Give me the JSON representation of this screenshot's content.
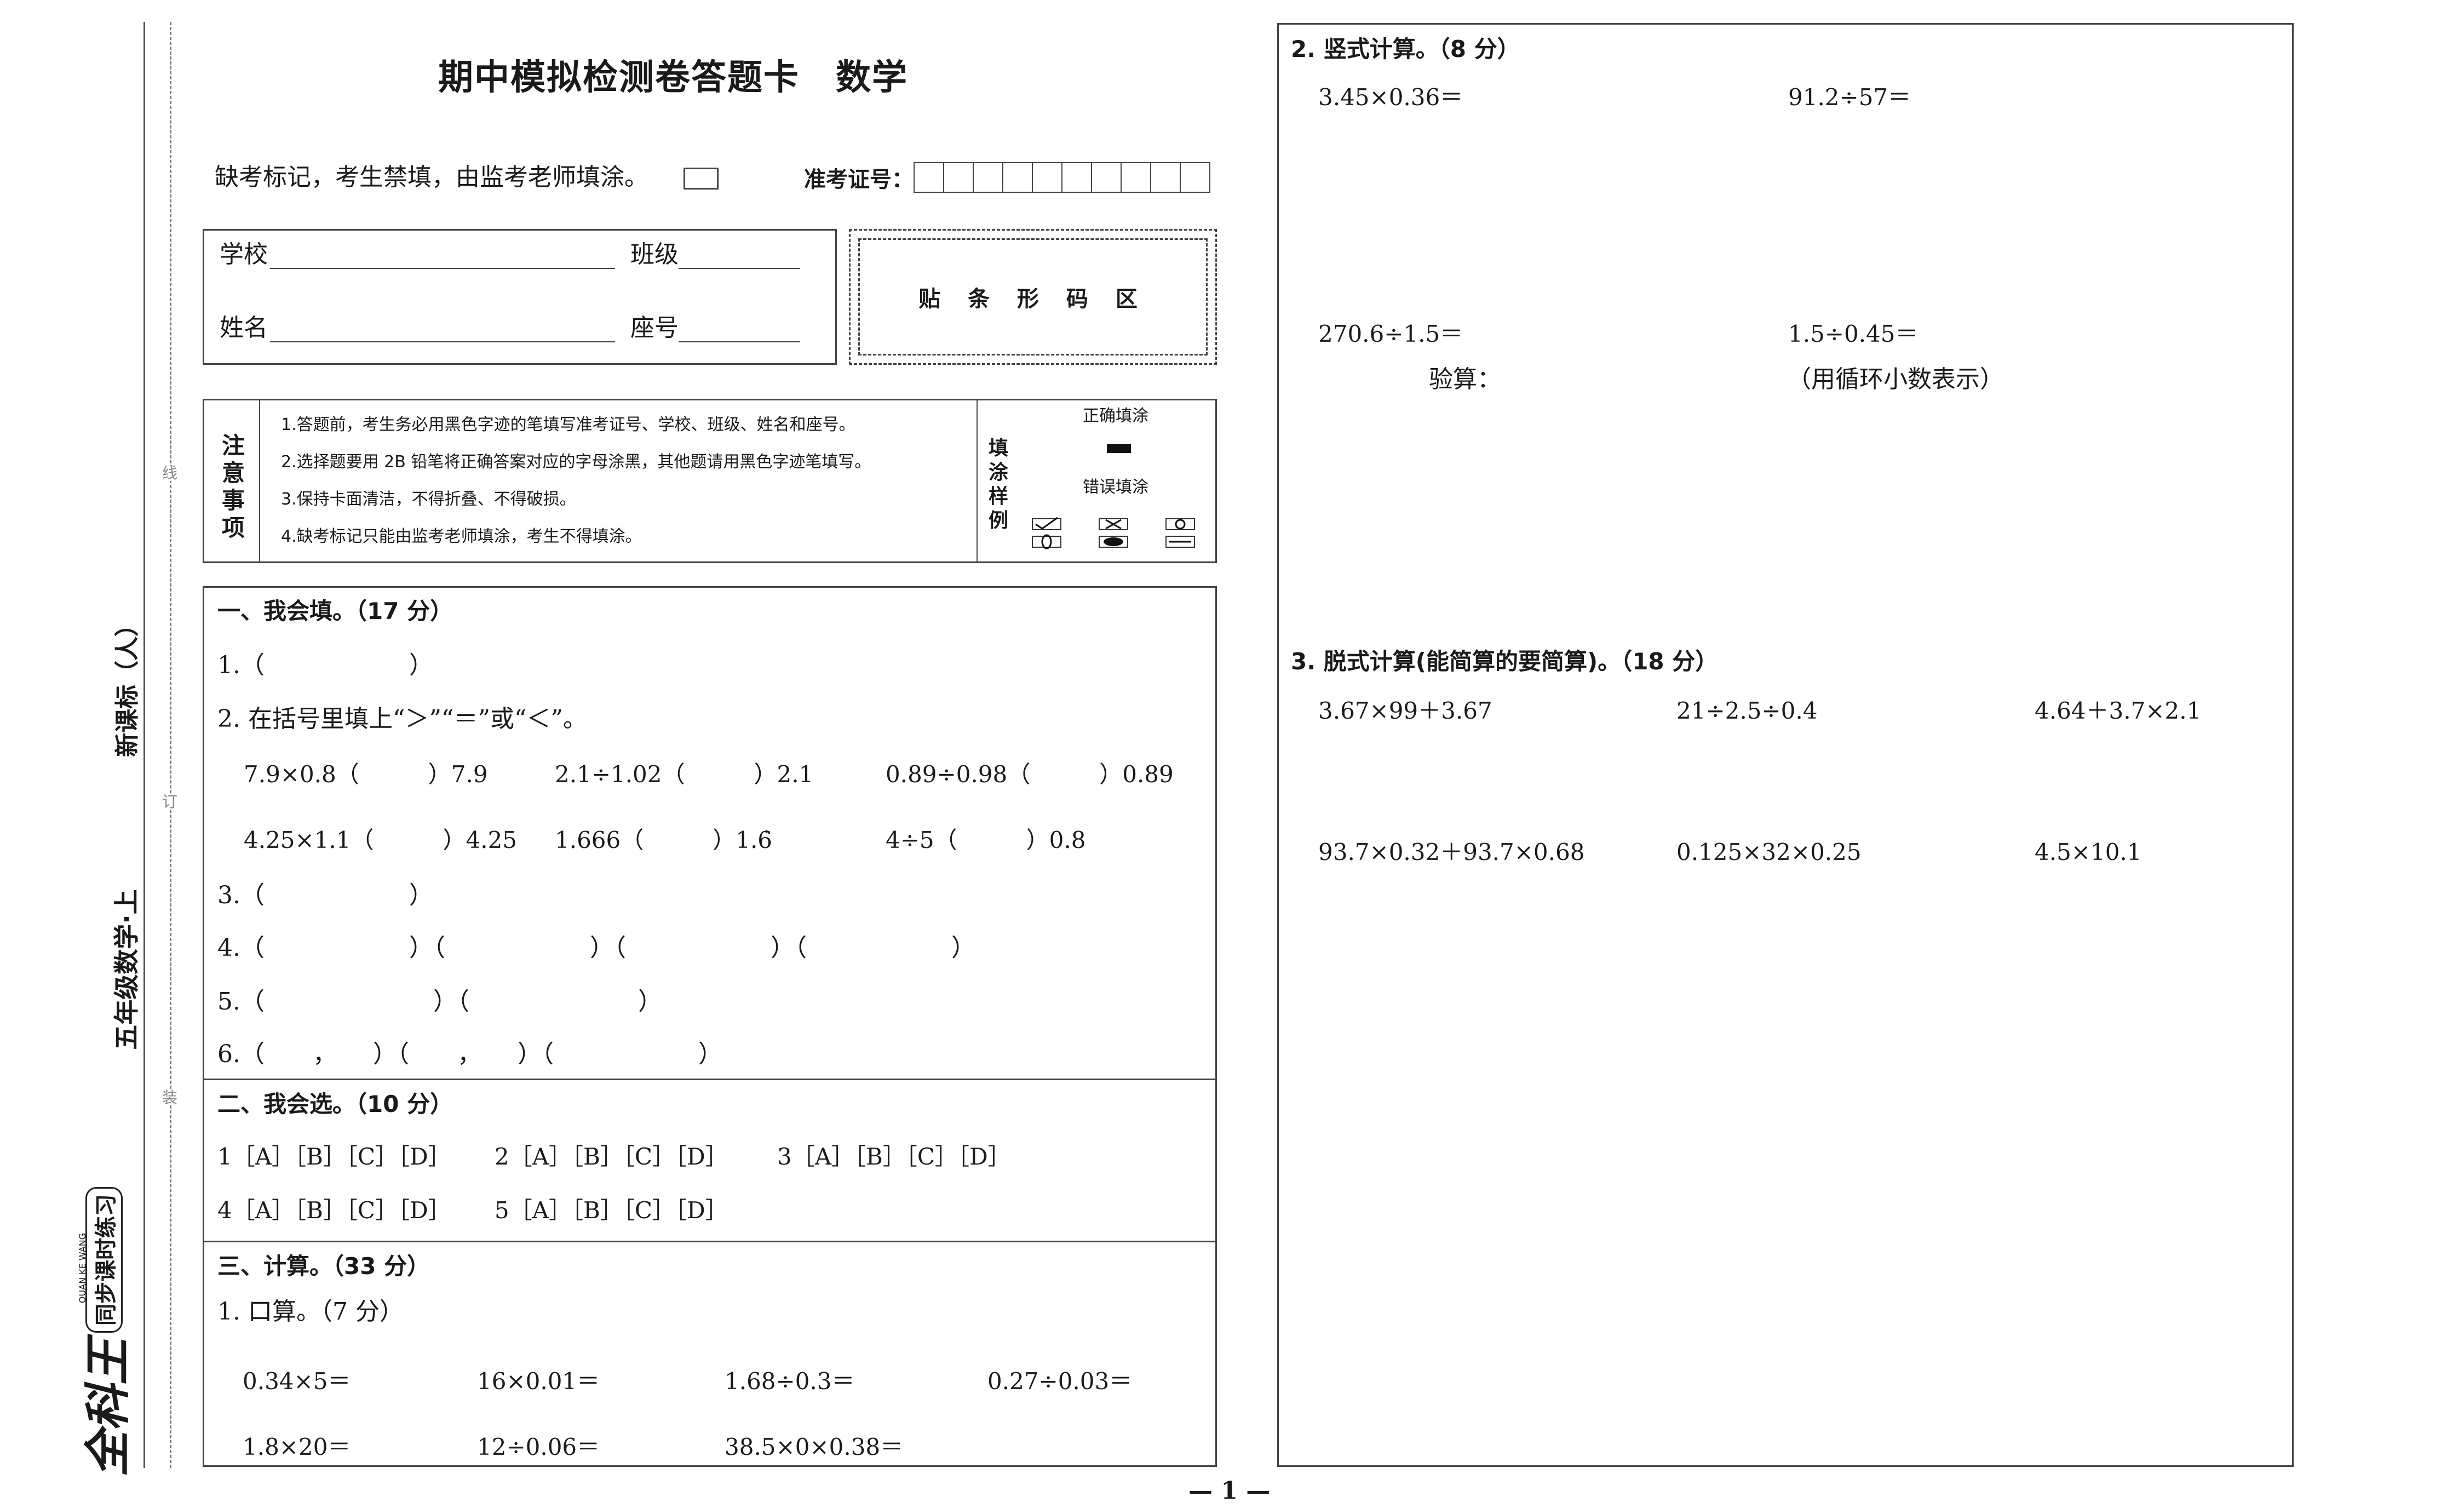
{
  "spine": {
    "edition": "新课标（人）",
    "grade_book": "五年级数学·上",
    "brand": "全科王",
    "brand_sub": "同步课时练习",
    "brand_pinyin": "QUAN KE WANG",
    "cut_marks": [
      "线",
      "订",
      "装"
    ]
  },
  "header": {
    "title": "期中模拟检测卷答题卡　数学",
    "absent_note": "缺考标记，考生禁填，由监考老师填涂。",
    "ticket_label": "准考证号："
  },
  "info": {
    "school_label": "学校",
    "class_label": "班级",
    "name_label": "姓名",
    "seat_label": "座号",
    "barcode_label": "贴 条 形 码 区"
  },
  "notice": {
    "heading": "注意事项",
    "items": [
      "1.答题前，考生务必用黑色字迹的笔填写准考证号、学校、班级、姓名和座号。",
      "2.选择题要用 2B 铅笔将正确答案对应的字母涂黑，其他题请用黑色字迹笔填写。",
      "3.保持卡面清洁，不得折叠、不得破损。",
      "4.缺考标记只能由监考老师填涂，考生不得填涂。"
    ],
    "sample_heading": "填涂样例",
    "correct_label": "正确填涂",
    "wrong_label": "错误填涂"
  },
  "section1": {
    "title": "一、我会填。（17 分）",
    "q1": "1.（　　　　　　）",
    "q2": "2. 在括号里填上“＞”“＝”或“＜”。",
    "q2_row1": [
      "7.9×0.8（　　　）7.9",
      "2.1÷1.02（　　　）2.1",
      "0.89÷0.98（　　　）0.89"
    ],
    "q2_row2": [
      "4.25×1.1（　　　）4.25",
      "1.666（　　　）1.6̇",
      "4÷5（　　　）0.8"
    ],
    "q3": "3.（　　　　　　）",
    "q4": "4.（　　　　　　）（　　　　　　）（　　　　　　）（　　　　　　）",
    "q5": "5.（　　　　　　　）（　　　　　　　）",
    "q6": "6.（　　，　　）（　　，　　）（　　　　　　）"
  },
  "section2": {
    "title": "二、我会选。（10 分）",
    "rows": [
      [
        "1［A］［B］［C］［D］",
        "2［A］［B］［C］［D］",
        "3［A］［B］［C］［D］"
      ],
      [
        "4［A］［B］［C］［D］",
        "5［A］［B］［C］［D］"
      ]
    ]
  },
  "section3": {
    "title": "三、计算。（33 分）",
    "sub1": "1. 口算。（7 分）",
    "oral_row1": [
      "0.34×5＝",
      "16×0.01＝",
      "1.68÷0.3＝",
      "0.27÷0.03＝"
    ],
    "oral_row2": [
      "1.8×20＝",
      "12÷0.06＝",
      "38.5×0×0.38＝"
    ]
  },
  "right": {
    "sub2": "2. 竖式计算。（8 分）",
    "vertical": [
      "3.45×0.36＝",
      "91.2÷57＝",
      "270.6÷1.5＝",
      "1.5÷0.45＝"
    ],
    "check_label": "验算：",
    "repeat_note": "（用循环小数表示）",
    "sub3": "3. 脱式计算(能简算的要简算)。（18 分）",
    "step_row1": [
      "3.67×99＋3.67",
      "21÷2.5÷0.4",
      "4.64＋3.7×2.1"
    ],
    "step_row2": [
      "93.7×0.32＋93.7×0.68",
      "0.125×32×0.25",
      "4.5×10.1"
    ]
  },
  "footer": {
    "page": "— 1 —"
  }
}
